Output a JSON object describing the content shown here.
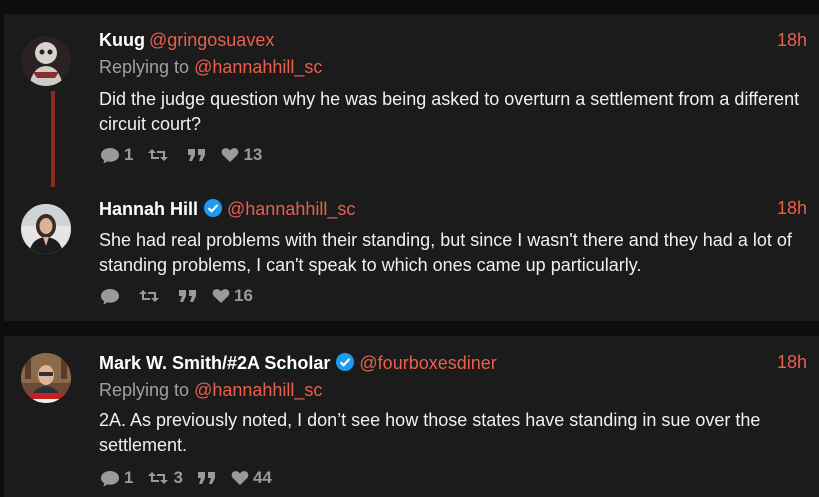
{
  "tweets": [
    {
      "name": "Kuug",
      "handle": "@gringosuavex",
      "time": "18h",
      "reply_prefix": "Replying to",
      "reply_handle": "@hannahhill_sc",
      "text": "Did the judge question why he was being asked to overturn a settlement from a different circuit court?",
      "replies": "1",
      "retweets": "",
      "likes": "13"
    },
    {
      "name": "Hannah Hill",
      "handle": "@hannahhill_sc",
      "time": "18h",
      "verified": true,
      "text": "She had real problems with their standing, but since I wasn't there and they had a lot of standing problems, I can't speak to which ones came up particularly.",
      "replies": "",
      "retweets": "",
      "likes": "16"
    },
    {
      "name": "Mark W. Smith/#2A Scholar",
      "handle": "@fourboxesdiner",
      "time": "18h",
      "verified": true,
      "reply_prefix": "Replying to",
      "reply_handle": "@hannahhill_sc",
      "text": "2A. As previously noted, I don’t see how those states have standing in sue over the settlement.",
      "replies": "1",
      "retweets": "3",
      "likes": "44"
    }
  ],
  "colors": {
    "background": "#0d0d0d",
    "card": "#1b1b1b",
    "accent": "#e8604c",
    "thread_line": "#8c2a20",
    "verified": "#1d9bf0"
  },
  "icons": [
    "reply-icon",
    "retweet-icon",
    "quote-icon",
    "heart-icon",
    "verified-icon"
  ]
}
